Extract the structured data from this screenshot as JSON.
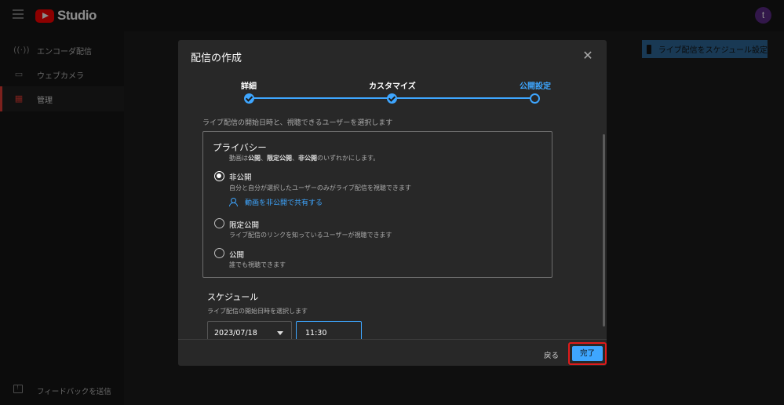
{
  "app": {
    "name": "Studio",
    "avatar_letter": "t"
  },
  "sidebar": {
    "items": [
      {
        "label": "エンコーダ配信",
        "icon": "broadcast-icon"
      },
      {
        "label": "ウェブカメラ",
        "icon": "camera-icon"
      },
      {
        "label": "管理",
        "icon": "calendar-icon",
        "active": true
      }
    ],
    "feedback_label": "フィードバックを送信"
  },
  "header": {
    "schedule_button": "ライブ配信をスケジュール設定"
  },
  "dialog": {
    "title": "配信の作成",
    "steps": [
      {
        "label": "詳細",
        "state": "done"
      },
      {
        "label": "カスタマイズ",
        "state": "done"
      },
      {
        "label": "公開設定",
        "state": "current"
      }
    ],
    "intro": "ライブ配信の開始日時と、視聴できるユーザーを選択します",
    "privacy": {
      "title": "プライバシー",
      "desc_prefix": "動画は",
      "desc_b1": "公開",
      "desc_sep1": "、",
      "desc_b2": "限定公開",
      "desc_sep2": "、",
      "desc_b3": "非公開",
      "desc_suffix": "のいずれかにします。",
      "options": [
        {
          "label": "非公開",
          "sub": "自分と自分が選択したユーザーのみがライブ配信を視聴できます",
          "selected": true
        },
        {
          "label": "限定公開",
          "sub": "ライブ配信のリンクを知っているユーザーが視聴できます",
          "selected": false
        },
        {
          "label": "公開",
          "sub": "誰でも視聴できます",
          "selected": false
        }
      ],
      "share_link": "動画を非公開で共有する"
    },
    "schedule": {
      "title": "スケジュール",
      "sub": "ライブ配信の開始日時を選択します",
      "date": "2023/07/18",
      "time": "11:30"
    },
    "footer": {
      "back": "戻る",
      "done": "完了"
    }
  },
  "colors": {
    "accent": "#3ea6ff",
    "brand_red": "#ff0000",
    "highlight": "#e01b1b"
  }
}
